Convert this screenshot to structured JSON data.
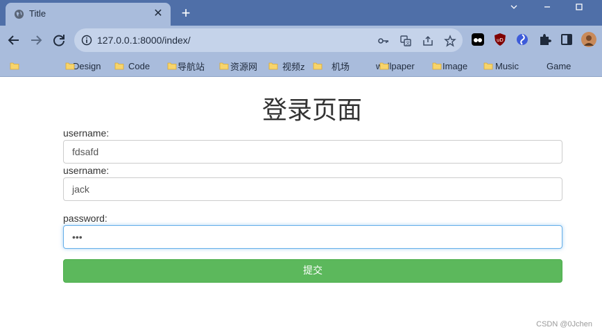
{
  "browser": {
    "tab_title": "Title",
    "tab_close": "✕",
    "new_tab": "+",
    "url": "127.0.0.1:8000/index/"
  },
  "bookmarks": [
    {
      "label": "Design"
    },
    {
      "label": "Code"
    },
    {
      "label": "导航站"
    },
    {
      "label": "资源网"
    },
    {
      "label": "视频z"
    },
    {
      "label": "机场"
    },
    {
      "label": "wallpaper"
    },
    {
      "label": "Image"
    },
    {
      "label": "Music"
    },
    {
      "label": "Game"
    }
  ],
  "form": {
    "title": "登录页面",
    "field1_label": "username:",
    "field1_value": "fdsafd",
    "field2_label": "username:",
    "field2_value": "jack",
    "password_label": "password:",
    "password_value": "•••",
    "submit_label": "提交"
  },
  "watermark": "CSDN @0Jchen",
  "colors": {
    "tab_strip": "#4f6fa8",
    "toolbar": "#a9bcdc",
    "submit_button": "#5cb85c",
    "focus_border": "#66afe9"
  }
}
